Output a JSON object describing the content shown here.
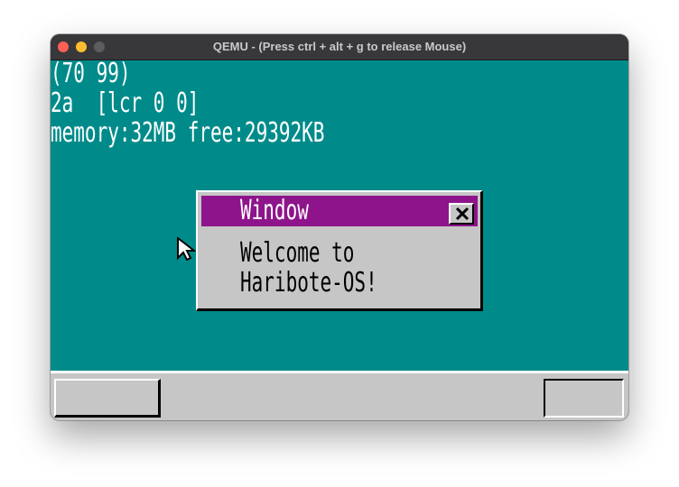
{
  "app": {
    "window_title": "QEMU - (Press ctrl + alt + g to release Mouse)"
  },
  "console": {
    "lines": [
      "(70 99)",
      "2a  [lcr 0 0]",
      "memory:32MB free:29392KB"
    ]
  },
  "haribote_window": {
    "title": "Window",
    "message_lines": [
      "Welcome to",
      "Haribote-OS!"
    ],
    "close_icon": "close-icon"
  },
  "colors": {
    "desktop": "#008b8a",
    "window_titlebar": "#8e148c",
    "gray": "#c6c6c6"
  },
  "icons": {
    "cursor": "mouse-cursor-icon",
    "close": "close-icon"
  }
}
